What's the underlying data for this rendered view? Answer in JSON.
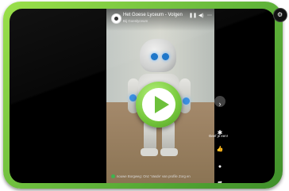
{
  "player": {
    "channel_name": "Het Goese Lyceum - Volgen",
    "channel_sub": "Bij Goeslyceum",
    "pause_icon": "pause-icon",
    "volume_icon": "volume-icon",
    "caption_text": "nouwe Borgweg: Onz 'Vasde' van profile Zorg en",
    "side": {
      "next_icon": "chevron-right-icon",
      "share_label": "Geef je een!",
      "like_icon": "thumbs-up-icon",
      "comment_icon": "comment-icon",
      "forward_icon": "share-icon"
    }
  },
  "colors": {
    "frame_green": "#62b53a",
    "play_green": "#6cc03a"
  }
}
